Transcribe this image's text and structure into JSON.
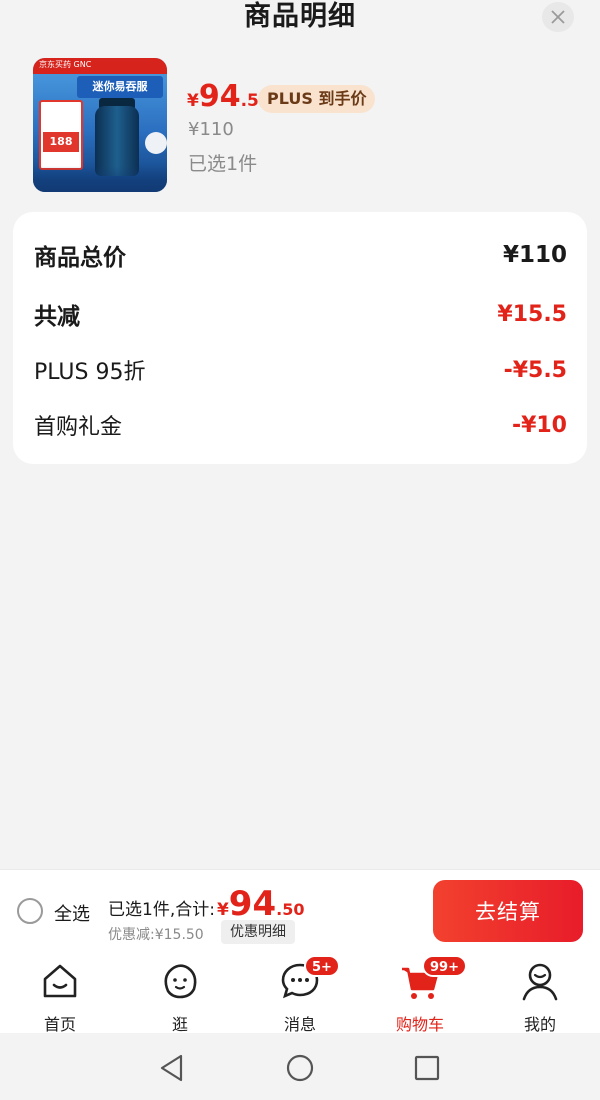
{
  "header": {
    "title": "商品明细"
  },
  "product": {
    "price_currency": "¥",
    "price_integer": "94",
    "price_decimal": ".5",
    "plus_tag": "PLUS 到手价",
    "original_price": "¥110",
    "selected_count": "已选1件",
    "image_text": {
      "brand": "京东买药 GNC",
      "headline": "迷你易吞服",
      "card_price": "188"
    }
  },
  "details": {
    "rows": [
      {
        "label": "商品总价",
        "value": "¥110"
      },
      {
        "label": "共减",
        "value": "¥15.5"
      },
      {
        "label": "PLUS 95折",
        "value": "-¥5.5"
      },
      {
        "label": "首购礼金",
        "value": "-¥10"
      }
    ]
  },
  "checkout": {
    "select_all": "全选",
    "summary_text": "已选1件,合计:",
    "total_currency": "¥",
    "total_integer": "94",
    "total_decimal": ".50",
    "discount": "优惠减:¥15.50",
    "detail_button": "优惠明细",
    "checkout_button": "去结算"
  },
  "tabs": [
    {
      "label": "首页",
      "icon": "home-icon"
    },
    {
      "label": "逛",
      "icon": "browse-icon"
    },
    {
      "label": "消息",
      "icon": "message-icon",
      "badge": "5+"
    },
    {
      "label": "购物车",
      "icon": "cart-icon",
      "badge": "99+",
      "active": true
    },
    {
      "label": "我的",
      "icon": "profile-icon"
    }
  ],
  "colors": {
    "accent": "#e2231a",
    "plus_tag_bg": "#f9e3cf",
    "background": "#f3f3f3"
  }
}
